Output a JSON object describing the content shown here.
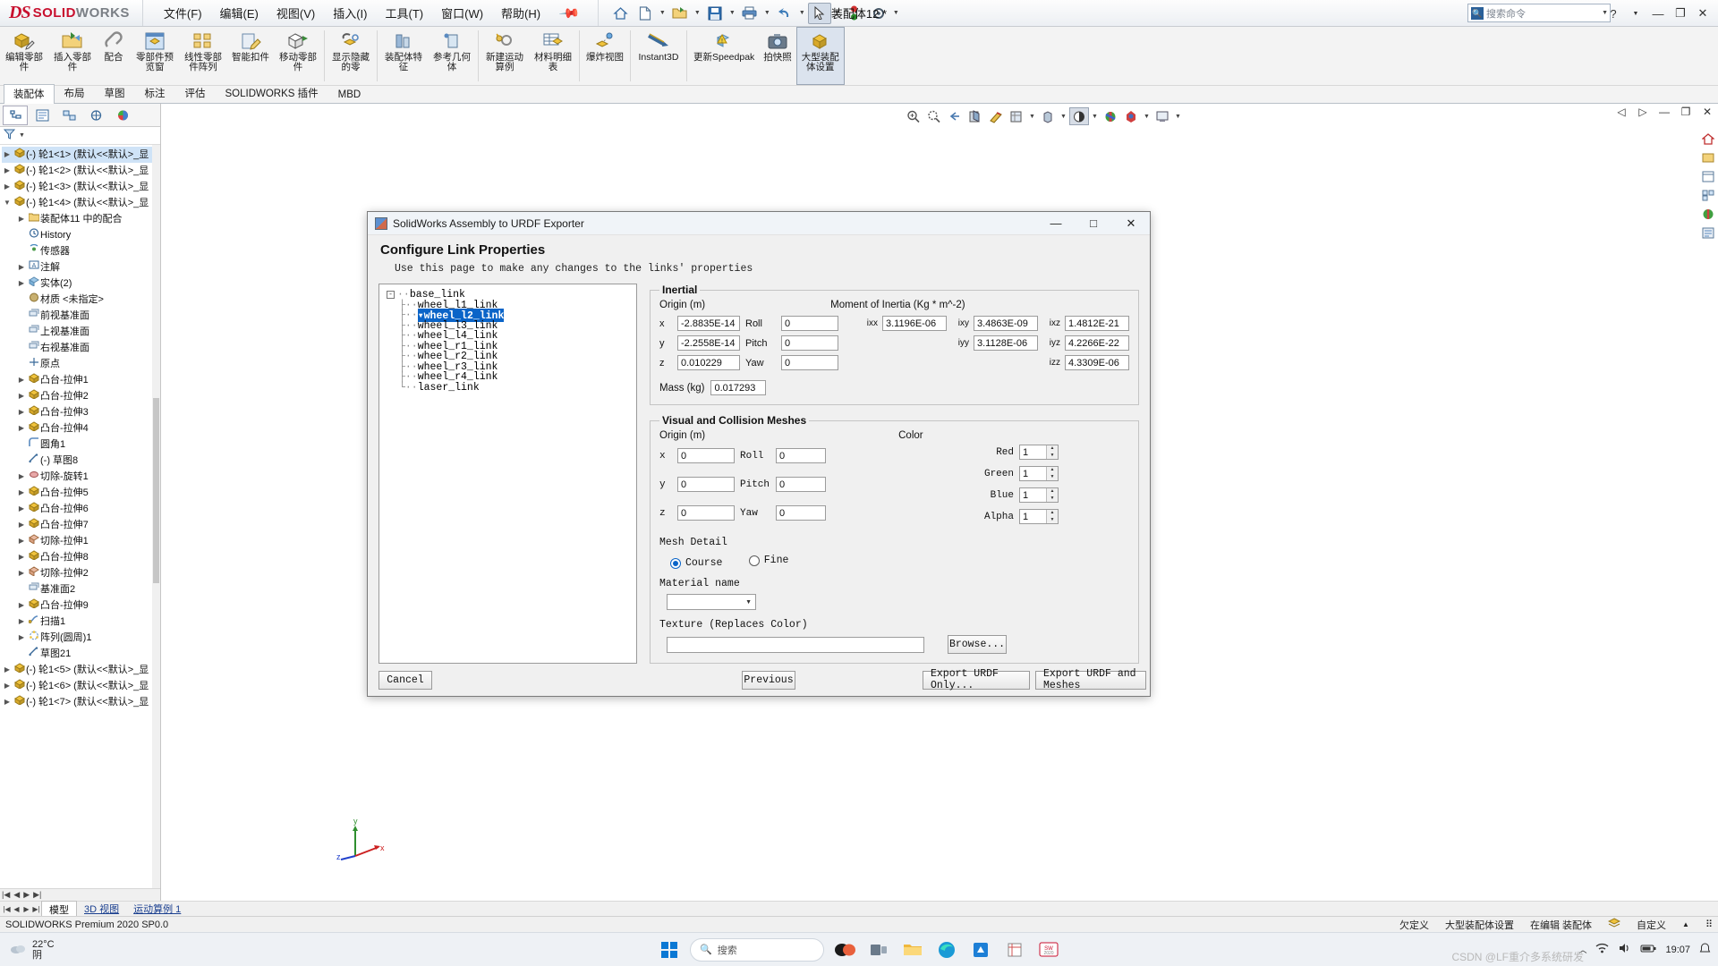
{
  "titlebar": {
    "logo_ds": "DS",
    "logo_solid": "SOLID",
    "logo_works": "WORKS",
    "menus": [
      "文件(F)",
      "编辑(E)",
      "视图(V)",
      "插入(I)",
      "工具(T)",
      "窗口(W)",
      "帮助(H)"
    ],
    "doc_title": "装配体12 *",
    "search_placeholder": "搜索命令",
    "quick_access": [
      "home-icon",
      "new-doc-icon",
      "open-folder-icon",
      "save-icon",
      "print-icon",
      "undo-icon",
      "select-arrow-icon",
      "rebuild-icon",
      "options-gear-icon"
    ]
  },
  "ribbon": {
    "buttons": [
      {
        "label": "编辑零部件",
        "icon": "edit-component-icon"
      },
      {
        "label": "插入零部件",
        "icon": "insert-component-icon"
      },
      {
        "label": "配合",
        "icon": "mate-icon"
      },
      {
        "label": "零部件预览窗",
        "icon": "component-preview-icon"
      },
      {
        "label": "线性零部件阵列",
        "icon": "linear-pattern-icon"
      },
      {
        "label": "智能扣件",
        "icon": "smart-fastener-icon"
      },
      {
        "label": "移动零部件",
        "icon": "move-component-icon"
      },
      {
        "label": "显示隐藏的零",
        "icon": "show-hidden-icon"
      },
      {
        "label": "装配体特征",
        "icon": "assembly-feature-icon"
      },
      {
        "label": "参考几何体",
        "icon": "reference-geometry-icon"
      },
      {
        "label": "新建运动算例",
        "icon": "motion-study-icon"
      },
      {
        "label": "材料明细表",
        "icon": "bom-icon"
      },
      {
        "label": "爆炸视图",
        "icon": "exploded-view-icon"
      },
      {
        "label": "Instant3D",
        "icon": "instant3d-icon"
      },
      {
        "label": "更新Speedpak",
        "icon": "update-speedpak-icon"
      },
      {
        "label": "拍快照",
        "icon": "snapshot-icon"
      },
      {
        "label": "大型装配体设置",
        "icon": "large-assembly-icon"
      }
    ]
  },
  "tabs": {
    "items": [
      "装配体",
      "布局",
      "草图",
      "标注",
      "评估",
      "SOLIDWORKS 插件",
      "MBD"
    ],
    "selected": "装配体"
  },
  "feature_manager": {
    "tab_icons": [
      "feature-tree-icon",
      "property-manager-icon",
      "configuration-manager-icon",
      "dimxpert-icon",
      "display-manager-icon"
    ],
    "filter_placeholder": "",
    "tree": [
      {
        "label": "(-) 轮1<1> (默认<<默认>_显",
        "depth": 0,
        "icon": "part-icon",
        "expandable": true,
        "selected": true
      },
      {
        "label": "(-) 轮1<2> (默认<<默认>_显",
        "depth": 0,
        "icon": "part-icon",
        "expandable": true
      },
      {
        "label": "(-) 轮1<3> (默认<<默认>_显",
        "depth": 0,
        "icon": "part-icon",
        "expandable": true
      },
      {
        "label": "(-) 轮1<4> (默认<<默认>_显",
        "depth": 0,
        "icon": "part-icon",
        "expandable": true,
        "expanded": true
      },
      {
        "label": "装配体11 中的配合",
        "depth": 1,
        "icon": "mates-folder-icon",
        "expandable": true
      },
      {
        "label": "History",
        "depth": 1,
        "icon": "history-icon"
      },
      {
        "label": "传感器",
        "depth": 1,
        "icon": "sensor-icon"
      },
      {
        "label": "注解",
        "depth": 1,
        "icon": "annotations-icon",
        "expandable": true
      },
      {
        "label": "实体(2)",
        "depth": 1,
        "icon": "solid-bodies-icon",
        "expandable": true
      },
      {
        "label": "材质 <未指定>",
        "depth": 1,
        "icon": "material-icon"
      },
      {
        "label": "前视基准面",
        "depth": 1,
        "icon": "plane-icon"
      },
      {
        "label": "上视基准面",
        "depth": 1,
        "icon": "plane-icon"
      },
      {
        "label": "右视基准面",
        "depth": 1,
        "icon": "plane-icon"
      },
      {
        "label": "原点",
        "depth": 1,
        "icon": "origin-icon"
      },
      {
        "label": "凸台-拉伸1",
        "depth": 1,
        "icon": "boss-extrude-icon",
        "expandable": true
      },
      {
        "label": "凸台-拉伸2",
        "depth": 1,
        "icon": "boss-extrude-icon",
        "expandable": true
      },
      {
        "label": "凸台-拉伸3",
        "depth": 1,
        "icon": "boss-extrude-icon",
        "expandable": true
      },
      {
        "label": "凸台-拉伸4",
        "depth": 1,
        "icon": "boss-extrude-icon",
        "expandable": true
      },
      {
        "label": "圆角1",
        "depth": 1,
        "icon": "fillet-icon"
      },
      {
        "label": "(-) 草图8",
        "depth": 1,
        "icon": "sketch-icon"
      },
      {
        "label": "切除-旋转1",
        "depth": 1,
        "icon": "cut-revolve-icon",
        "expandable": true
      },
      {
        "label": "凸台-拉伸5",
        "depth": 1,
        "icon": "boss-extrude-icon",
        "expandable": true
      },
      {
        "label": "凸台-拉伸6",
        "depth": 1,
        "icon": "boss-extrude-icon",
        "expandable": true
      },
      {
        "label": "凸台-拉伸7",
        "depth": 1,
        "icon": "boss-extrude-icon",
        "expandable": true
      },
      {
        "label": "切除-拉伸1",
        "depth": 1,
        "icon": "cut-extrude-icon",
        "expandable": true
      },
      {
        "label": "凸台-拉伸8",
        "depth": 1,
        "icon": "boss-extrude-icon",
        "expandable": true
      },
      {
        "label": "切除-拉伸2",
        "depth": 1,
        "icon": "cut-extrude-icon",
        "expandable": true
      },
      {
        "label": "基准面2",
        "depth": 1,
        "icon": "plane-icon"
      },
      {
        "label": "凸台-拉伸9",
        "depth": 1,
        "icon": "boss-extrude-icon",
        "expandable": true
      },
      {
        "label": "扫描1",
        "depth": 1,
        "icon": "sweep-icon",
        "expandable": true
      },
      {
        "label": "阵列(圆周)1",
        "depth": 1,
        "icon": "circular-pattern-icon",
        "expandable": true
      },
      {
        "label": "草图21",
        "depth": 1,
        "icon": "sketch-icon"
      },
      {
        "label": "(-) 轮1<5> (默认<<默认>_显",
        "depth": 0,
        "icon": "part-icon",
        "expandable": true
      },
      {
        "label": "(-) 轮1<6> (默认<<默认>_显",
        "depth": 0,
        "icon": "part-icon",
        "expandable": true
      },
      {
        "label": "(-) 轮1<7> (默认<<默认>_显",
        "depth": 0,
        "icon": "part-icon",
        "expandable": true
      }
    ]
  },
  "dialog": {
    "window_title": "SolidWorks Assembly to URDF Exporter",
    "page_title": "Configure Link Properties",
    "page_subtitle": "Use this page to make any changes to the links' properties",
    "link_tree": [
      {
        "label": "base_link",
        "depth": 0,
        "expander": "-"
      },
      {
        "label": "wheel_l1_link",
        "depth": 1
      },
      {
        "label": "wheel_l2_link",
        "depth": 1,
        "selected": true
      },
      {
        "label": "wheel_l3_link",
        "depth": 1
      },
      {
        "label": "wheel_l4_link",
        "depth": 1
      },
      {
        "label": "wheel_r1_link",
        "depth": 1
      },
      {
        "label": "wheel_r2_link",
        "depth": 1
      },
      {
        "label": "wheel_r3_link",
        "depth": 1
      },
      {
        "label": "wheel_r4_link",
        "depth": 1
      },
      {
        "label": "laser_link",
        "depth": 1
      }
    ],
    "inertial": {
      "legend": "Inertial",
      "origin_label": "Origin (m)",
      "moment_label": "Moment of Inertia (Kg * m^-2)",
      "x_label": "x",
      "x_value": "-2.8835E-14",
      "y_label": "y",
      "y_value": "-2.2558E-14",
      "z_label": "z",
      "z_value": "0.010229",
      "roll_label": "Roll",
      "roll_value": "0",
      "pitch_label": "Pitch",
      "pitch_value": "0",
      "yaw_label": "Yaw",
      "yaw_value": "0",
      "ixx_label": "ixx",
      "ixx_value": "3.1196E-06",
      "ixy_label": "ixy",
      "ixy_value": "3.4863E-09",
      "ixz_label": "ixz",
      "ixz_value": "1.4812E-21",
      "iyy_label": "iyy",
      "iyy_value": "3.1128E-06",
      "iyz_label": "iyz",
      "iyz_value": "4.2266E-22",
      "izz_label": "izz",
      "izz_value": "4.3309E-06",
      "mass_label": "Mass (kg)",
      "mass_value": "0.017293"
    },
    "visual": {
      "legend": "Visual and Collision Meshes",
      "origin_label": "Origin (m)",
      "x_label": "x",
      "x_value": "0",
      "y_label": "y",
      "y_value": "0",
      "z_label": "z",
      "z_value": "0",
      "roll_label": "Roll",
      "roll_value": "0",
      "pitch_label": "Pitch",
      "pitch_value": "0",
      "yaw_label": "Yaw",
      "yaw_value": "0",
      "color_label": "Color",
      "red_label": "Red",
      "red_value": "1",
      "green_label": "Green",
      "green_value": "1",
      "blue_label": "Blue",
      "blue_value": "1",
      "alpha_label": "Alpha",
      "alpha_value": "1",
      "mesh_detail_label": "Mesh Detail",
      "course_label": "Course",
      "fine_label": "Fine",
      "mesh_detail_selected": "Course",
      "material_name_label": "Material name",
      "material_name_value": "",
      "texture_label": "Texture (Replaces Color)",
      "texture_value": "",
      "browse_label": "Browse..."
    },
    "buttons": {
      "cancel": "Cancel",
      "previous": "Previous",
      "export_urdf_only": "Export URDF Only...",
      "export_urdf_and_meshes": "Export URDF and Meshes"
    },
    "window_controls": {
      "minimize": "—",
      "maximize": "□",
      "close": "✕"
    }
  },
  "bottom_tabs": {
    "items": [
      "模型",
      "3D 视图",
      "运动算例 1"
    ],
    "selected": "模型"
  },
  "statusbar": {
    "left": "SOLIDWORKS Premium 2020 SP0.0",
    "right_items": [
      "欠定义",
      "大型装配体设置",
      "在编辑 装配体",
      "自定义"
    ]
  },
  "taskbar": {
    "weather_temp": "22°C",
    "weather_desc": "阴",
    "search_placeholder": "搜索",
    "clock_time": "19:07",
    "apps": [
      "widgets-icon",
      "search-icon",
      "copilot-icon",
      "task-view-icon",
      "file-explorer-icon",
      "edge-icon",
      "store-icon",
      "snip-icon",
      "solidworks-icon"
    ],
    "watermark": "CSDN @LF重介多系统研发"
  },
  "colors": {
    "brand_red": "#c8102e",
    "accent_blue": "#0a64c8",
    "selection_blue": "#cfe3f7"
  }
}
